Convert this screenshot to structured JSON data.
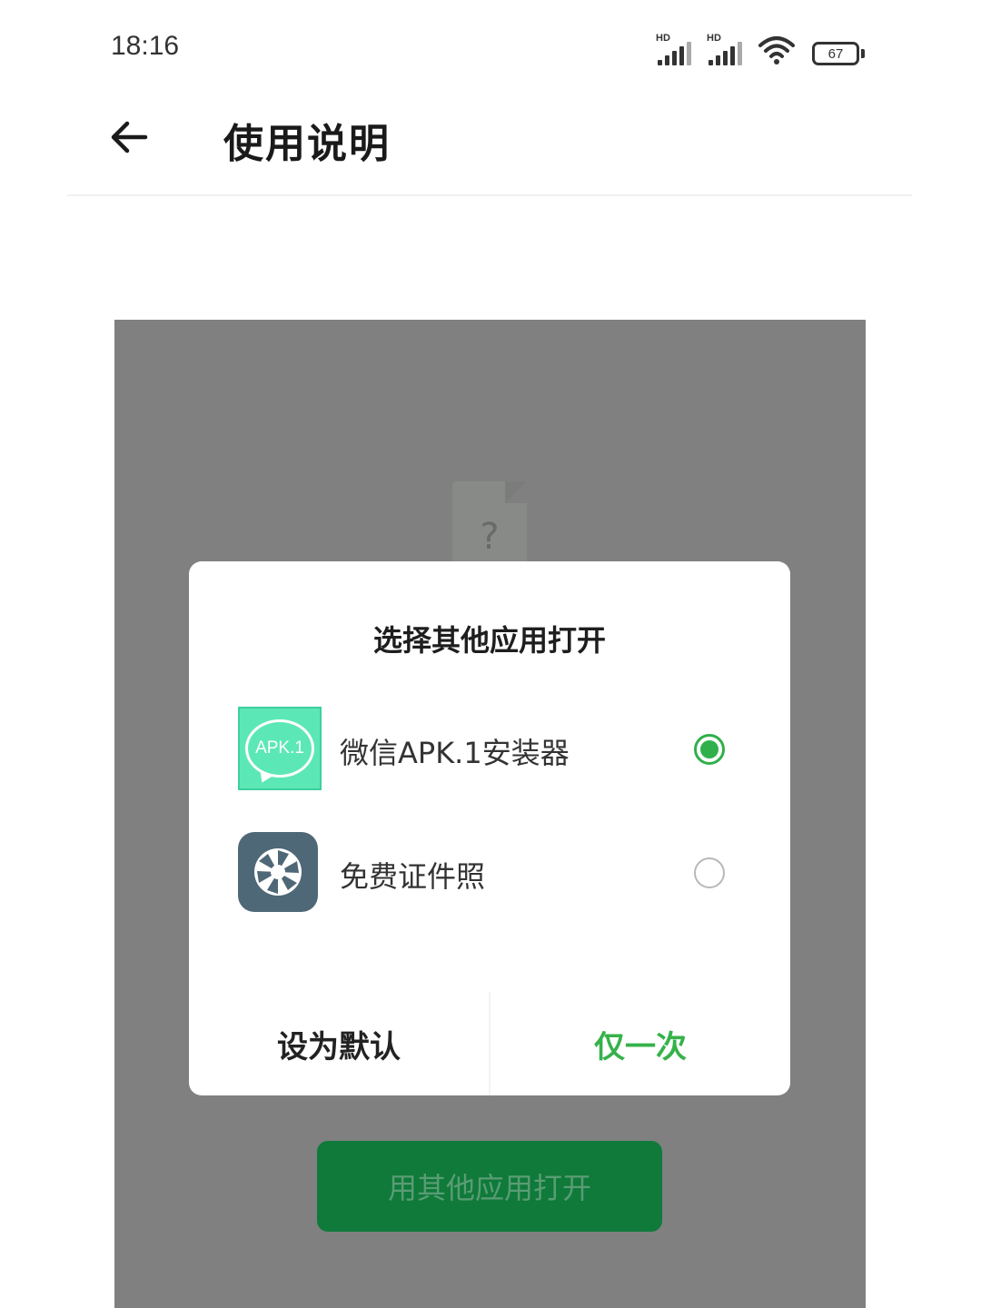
{
  "status_bar": {
    "time": "18:16",
    "signal1_label": "HD",
    "signal2_label": "HD",
    "battery_level": "67"
  },
  "app_bar": {
    "title": "使用说明",
    "back_icon": "arrow-left-icon"
  },
  "screenshot": {
    "file_placeholder_glyph": "?",
    "dialog": {
      "title": "选择其他应用打开",
      "options": [
        {
          "label": "微信APK.1安装器",
          "icon": "apk-installer-icon",
          "icon_text": "APK.1",
          "selected": true
        },
        {
          "label": "免费证件照",
          "icon": "camera-aperture-icon",
          "selected": false
        }
      ],
      "buttons": {
        "set_default": "设为默认",
        "just_once": "仅一次"
      }
    },
    "open_other_button": "用其他应用打开"
  },
  "colors": {
    "accent_green": "#35b24a",
    "panel_gray": "#808080",
    "primary_button": "#0f7a3a"
  }
}
